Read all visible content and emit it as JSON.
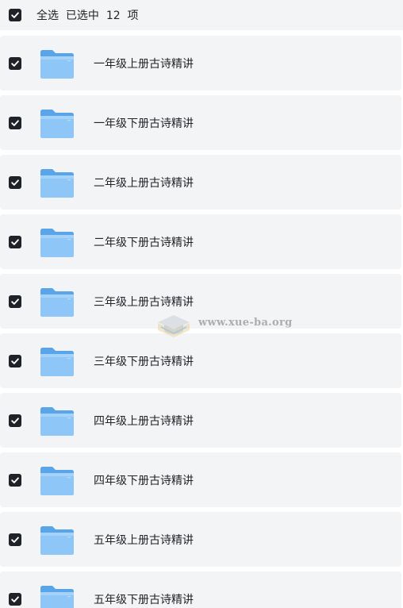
{
  "header": {
    "select_all_label": "全选",
    "selected_prefix": "已选中",
    "selected_count": "12",
    "selected_suffix": "项",
    "checked": true
  },
  "folders": [
    {
      "name": "一年级上册古诗精讲",
      "checked": true
    },
    {
      "name": "一年级下册古诗精讲",
      "checked": true
    },
    {
      "name": "二年级上册古诗精讲",
      "checked": true
    },
    {
      "name": "二年级下册古诗精讲",
      "checked": true
    },
    {
      "name": "三年级上册古诗精讲",
      "checked": true
    },
    {
      "name": "三年级下册古诗精讲",
      "checked": true
    },
    {
      "name": "四年级上册古诗精讲",
      "checked": true
    },
    {
      "name": "四年级下册古诗精讲",
      "checked": true
    },
    {
      "name": "五年级上册古诗精讲",
      "checked": true
    },
    {
      "name": "五年级下册古诗精讲",
      "checked": true
    }
  ],
  "watermark": {
    "text": "www.xue-ba.org"
  },
  "colors": {
    "checkbox_fill": "#1f2329",
    "row_background": "#f3f4f6",
    "folder_blue": "#6fb6f4",
    "text": "#222428"
  },
  "icons": {
    "checkbox": "checkbox-checked-icon",
    "folder": "folder-icon"
  }
}
